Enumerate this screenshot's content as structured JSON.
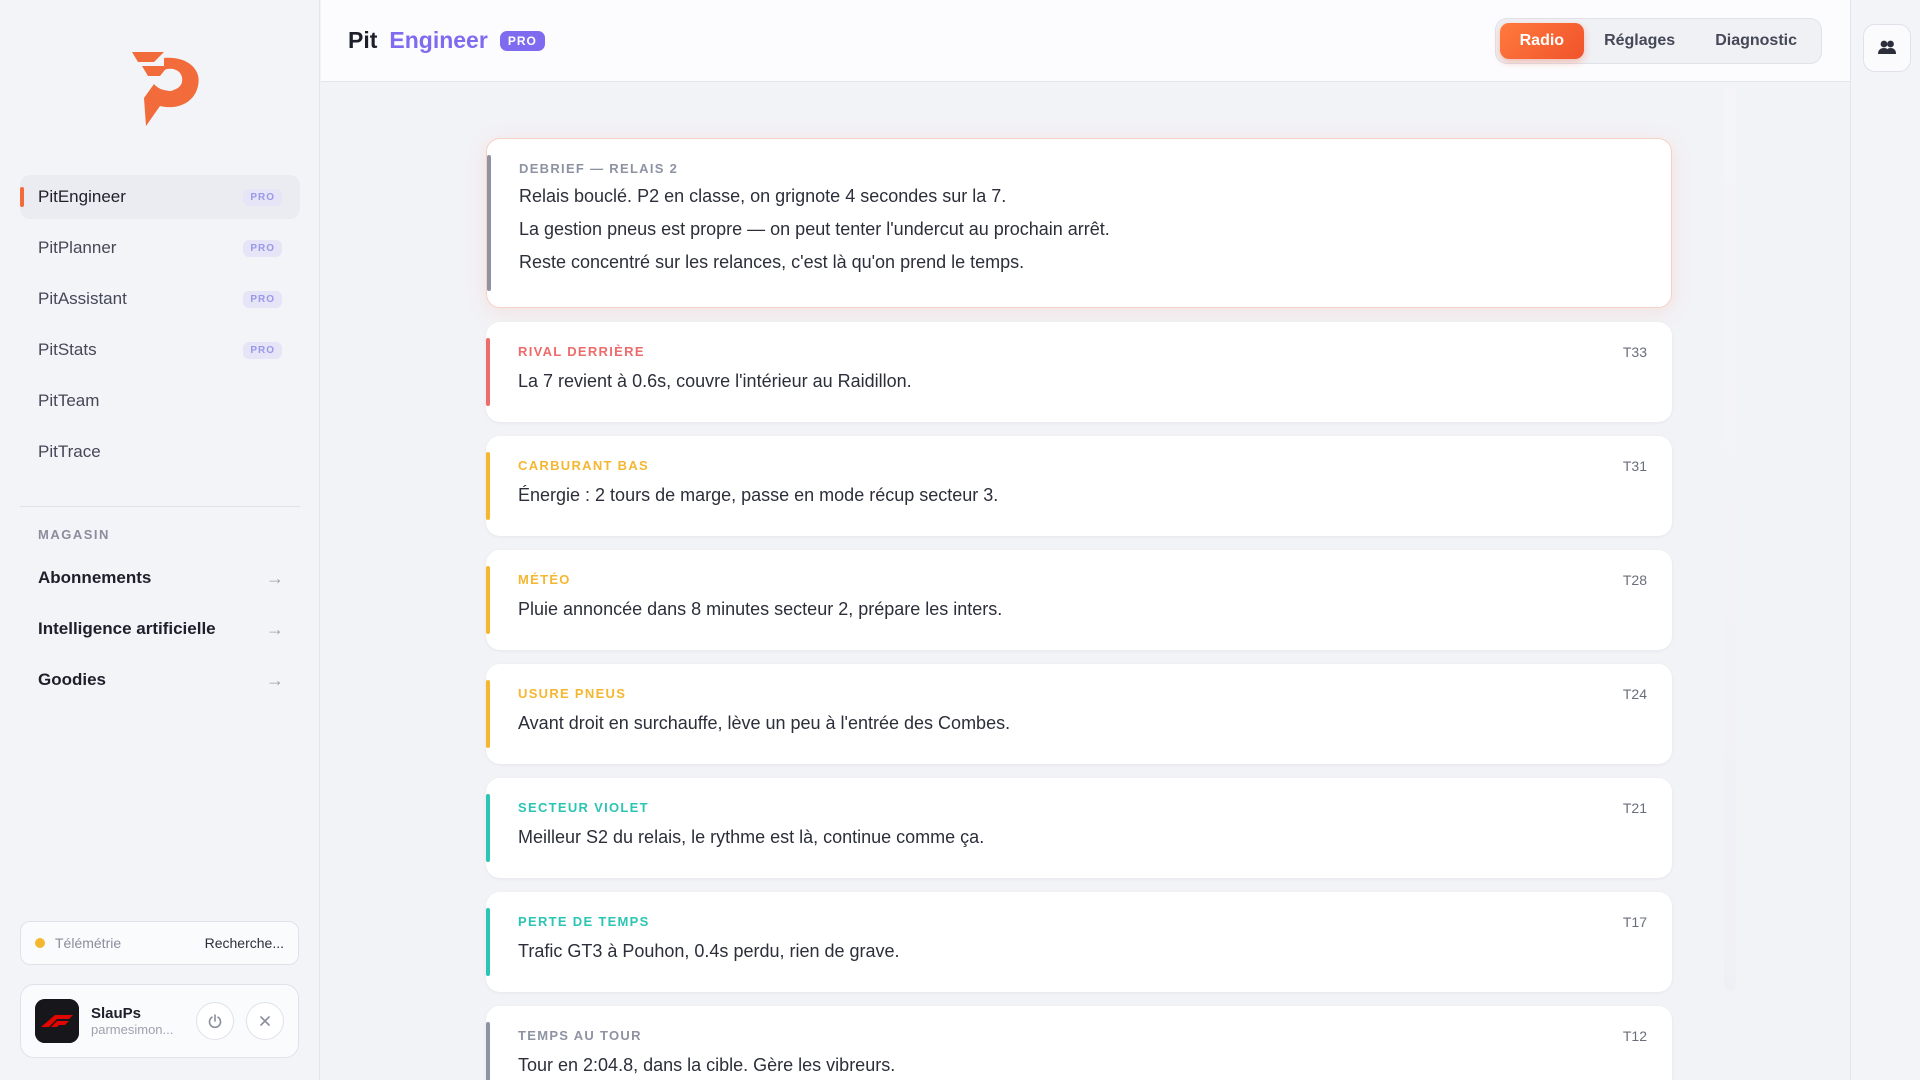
{
  "app": {
    "brand_pit": "Pit",
    "brand_engineer": "Engineer",
    "brand_badge": "PRO"
  },
  "sidebar": {
    "items": [
      {
        "label": "PitEngineer",
        "badge": "PRO"
      },
      {
        "label": "PitPlanner",
        "badge": "PRO"
      },
      {
        "label": "PitAssistant",
        "badge": "PRO"
      },
      {
        "label": "PitStats",
        "badge": "PRO"
      },
      {
        "label": "PitTeam"
      },
      {
        "label": "PitTrace"
      }
    ],
    "shop_title": "MAGASIN",
    "shop_items": [
      {
        "label": "Abonnements",
        "arrow": "→"
      },
      {
        "label": "Intelligence artificielle",
        "arrow": "→"
      },
      {
        "label": "Goodies",
        "arrow": "→"
      }
    ],
    "telemetry": {
      "label": "Télémétrie",
      "status": "Recherche..."
    },
    "user": {
      "name": "SlauPs",
      "sub": "parmesimon..."
    }
  },
  "header": {
    "tabs": [
      "Radio",
      "Réglages",
      "Diagnostic"
    ]
  },
  "feed": {
    "debrief": {
      "tag": "DEBRIEF — RELAIS 2",
      "lines": [
        "Relais bouclé. P2 en classe, on grignote 4 secondes sur la 7.",
        "La gestion pneus est propre — on peut tenter l'undercut au prochain arrêt.",
        "Reste concentré sur les relances, c'est là qu'on prend le temps."
      ]
    },
    "messages": [
      {
        "tag": "RIVAL DERRIÈRE",
        "lap": "T33",
        "text": "La 7 revient à 0.6s, couvre l'intérieur au Raidillon."
      },
      {
        "tag": "CARBURANT BAS",
        "lap": "T31",
        "text": "Énergie : 2 tours de marge, passe en mode récup secteur 3."
      },
      {
        "tag": "MÉTÉO",
        "lap": "T28",
        "text": "Pluie annoncée dans 8 minutes secteur 2, prépare les inters."
      },
      {
        "tag": "USURE PNEUS",
        "lap": "T24",
        "text": "Avant droit en surchauffe, lève un peu à l'entrée des Combes."
      },
      {
        "tag": "SECTEUR VIOLET",
        "lap": "T21",
        "text": "Meilleur S2 du relais, le rythme est là, continue comme ça."
      },
      {
        "tag": "PERTE DE TEMPS",
        "lap": "T17",
        "text": "Trafic GT3 à Pouhon, 0.4s perdu, rien de grave."
      },
      {
        "tag": "TEMPS AU TOUR",
        "lap": "T12",
        "text": "Tour en 2:04.8, dans la cible. Gère les vibreurs."
      }
    ]
  },
  "colors": {
    "accent_orange": "#f26b3a",
    "brand_violet": "#7f6bf0",
    "alert_red": "#ee6b6b",
    "warning_yellow": "#f5b731",
    "info_teal": "#2cc4b4",
    "neutral_gray": "#8e93a3"
  },
  "icons": {
    "logo": "pit-logo-icon",
    "power": "power-icon",
    "close": "close-icon",
    "team": "team-icon",
    "avatar": "f1-logo-icon"
  }
}
